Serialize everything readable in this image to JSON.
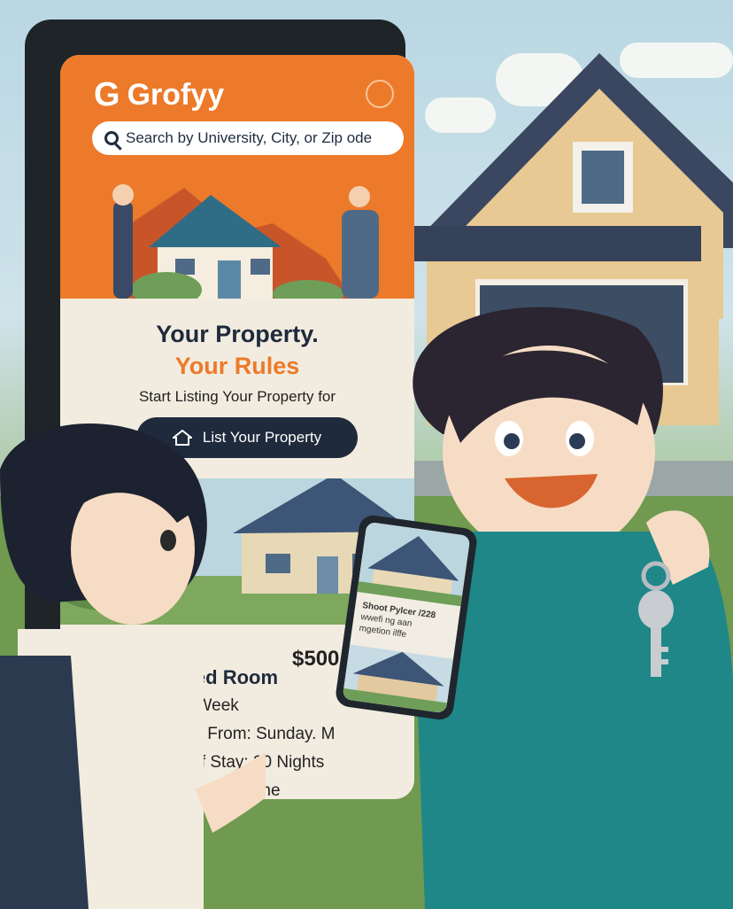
{
  "app": {
    "logo_mark": "G",
    "name": "Grofyy"
  },
  "search": {
    "placeholder": "Search by University, City, or Zip ode"
  },
  "hero": {
    "headline": "Your Property.",
    "accent": "Your Rules",
    "subtitle": "Start Listing Your Property for",
    "cta_label": "List Your Property"
  },
  "listing": {
    "price": "$500/",
    "title": "Shared Room",
    "rate": "1500/Week",
    "available": "ailable From: Sunday. M",
    "stay": "ngth of Stay: 20 Nights",
    "type": "gle Family Home"
  },
  "phone_card": {
    "title": "Shoot Pylcer  /228",
    "line1": "wwefi ng aan",
    "line2": "mgetion ilffe"
  },
  "colors": {
    "brand_orange": "#ec7a2a",
    "navy": "#1f2a3c",
    "cream": "#f2ece0"
  },
  "icons": [
    "search-icon",
    "home-icon",
    "menu-icon",
    "key-icon"
  ]
}
